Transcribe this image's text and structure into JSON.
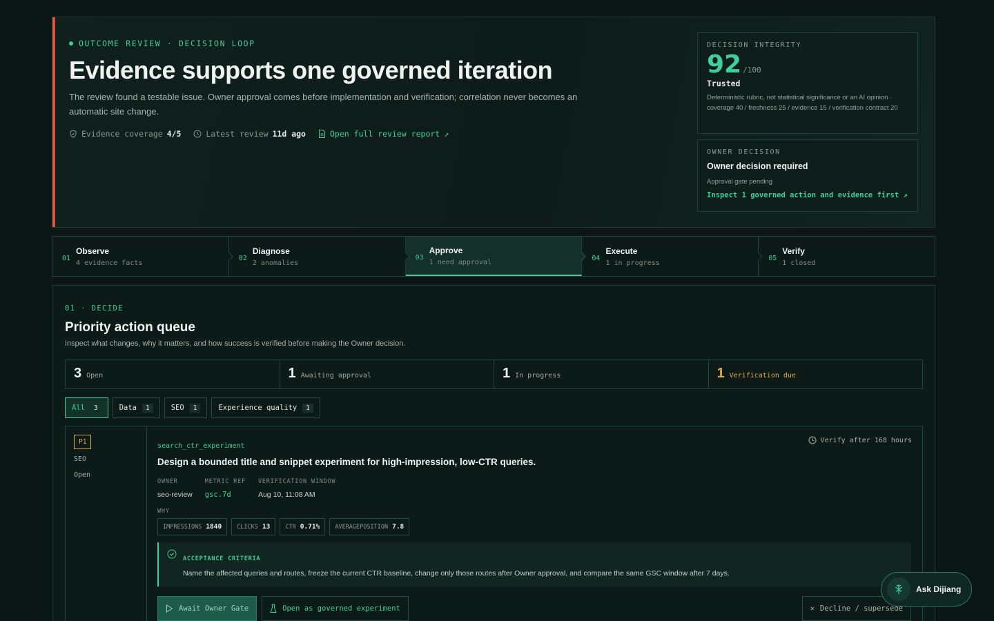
{
  "hero": {
    "eyebrow": "OUTCOME REVIEW · DECISION LOOP",
    "title": "Evidence supports one governed iteration",
    "description": "The review found a testable issue. Owner approval comes before implementation and verification; correlation never becomes an automatic site change.",
    "coverage_label": "Evidence coverage",
    "coverage_value": "4/5",
    "review_label": "Latest review",
    "review_value": "11d ago",
    "report_link": "Open full review report"
  },
  "integrity": {
    "label": "DECISION INTEGRITY",
    "score": "92",
    "denominator": "/100",
    "status": "Trusted",
    "rubric": "Deterministic rubric, not statistical significance or an AI opinion · coverage 40 / freshness 25 / evidence 15 / verification contract 20"
  },
  "owner_decision": {
    "label": "OWNER DECISION",
    "title": "Owner decision required",
    "subtitle": "Approval gate pending",
    "link": "Inspect 1 governed action and evidence first"
  },
  "steps": [
    {
      "num": "01",
      "name": "Observe",
      "sub": "4 evidence facts"
    },
    {
      "num": "02",
      "name": "Diagnose",
      "sub": "2 anomalies"
    },
    {
      "num": "03",
      "name": "Approve",
      "sub": "1 need approval"
    },
    {
      "num": "04",
      "name": "Execute",
      "sub": "1 in progress"
    },
    {
      "num": "05",
      "name": "Verify",
      "sub": "1 closed"
    }
  ],
  "queue": {
    "eyebrow": "01 · DECIDE",
    "title": "Priority action queue",
    "description": "Inspect what changes, why it matters, and how success is verified before making the Owner decision.",
    "stats": [
      {
        "num": "3",
        "label": "Open"
      },
      {
        "num": "1",
        "label": "Awaiting approval"
      },
      {
        "num": "1",
        "label": "In progress"
      },
      {
        "num": "1",
        "label": "Verification due"
      }
    ],
    "filters": [
      {
        "label": "All",
        "count": "3"
      },
      {
        "label": "Data",
        "count": "1"
      },
      {
        "label": "SEO",
        "count": "1"
      },
      {
        "label": "Experience quality",
        "count": "1"
      }
    ]
  },
  "item": {
    "priority": "P1",
    "category": "SEO",
    "status": "Open",
    "key": "search_ctr_experiment",
    "verify_after": "Verify after 168 hours",
    "title": "Design a bounded title and snippet experiment for high-impression, low-CTR queries.",
    "owner_label": "OWNER",
    "owner_value": "seo-review",
    "metric_label": "METRIC REF",
    "metric_value": "gsc.7d",
    "window_label": "VERIFICATION WINDOW",
    "window_value": "Aug 10, 11:08 AM",
    "why_label": "WHY",
    "metrics": [
      {
        "label": "IMPRESSIONS",
        "value": "1840"
      },
      {
        "label": "CLICKS",
        "value": "13"
      },
      {
        "label": "CTR",
        "value": "0.71%"
      },
      {
        "label": "AVERAGEPOSITION",
        "value": "7.8"
      }
    ],
    "acceptance_label": "ACCEPTANCE CRITERIA",
    "acceptance_text": "Name the affected queries and routes, freeze the current CTR baseline, change only those routes after Owner approval, and compare the same GSC window after 7 days.",
    "await_button": "Await Owner Gate",
    "open_button": "Open as governed experiment",
    "decline_button": "Decline / supersede"
  },
  "assistant": {
    "label": "Ask Dijiang"
  },
  "colors": {
    "accent": "#3fcf9c",
    "warning": "#e0a94a",
    "alert_bar": "#d4553f"
  }
}
